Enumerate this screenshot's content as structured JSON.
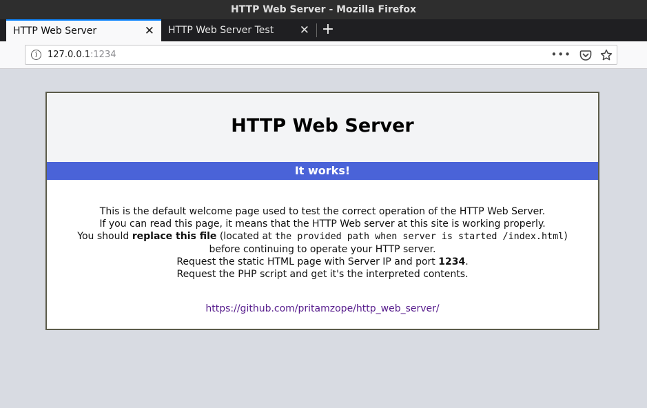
{
  "window": {
    "title": "HTTP Web Server - Mozilla Firefox"
  },
  "tabs": [
    {
      "label": "HTTP Web Server",
      "active": true
    },
    {
      "label": "HTTP Web Server Test",
      "active": false
    }
  ],
  "tab_close_glyph": "✕",
  "new_tab_glyph": "+",
  "urlbar": {
    "host": "127.0.0.1",
    "port": ":1234",
    "more_glyph": "•••"
  },
  "icons": [
    "info-icon",
    "close-icon",
    "plus-icon",
    "more-icon",
    "pocket-icon",
    "star-icon"
  ],
  "page": {
    "title": "HTTP Web Server",
    "banner": "It works!",
    "lines": {
      "l1": "This is the default welcome page used to test the correct operation of the HTTP Web Server.",
      "l2": "If you can read this page, it means that the HTTP Web server at this site is working properly.",
      "l3_pre": "You should ",
      "l3_bold": "replace this file",
      "l3_mid": " (located at ",
      "l3_mono": "the provided path when server is started /index.html",
      "l3_post": ")",
      "l4": "before continuing to operate your HTTP server.",
      "l5_pre": "Request the static HTML page with Server IP and port ",
      "l5_bold": "1234",
      "l5_post": ".",
      "l6": "Request the PHP script and get it's the interpreted contents."
    },
    "link": "https://github.com/pritamzope/http_web_server/"
  },
  "colors": {
    "banner_bg": "#4a63d8",
    "link": "#551a8b",
    "tab_accent": "#0a84ff",
    "page_bg": "#d8dbe2"
  }
}
